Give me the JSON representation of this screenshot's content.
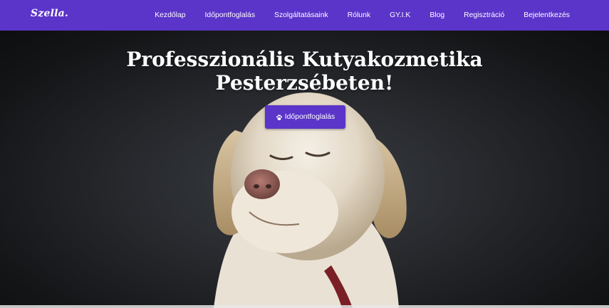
{
  "brand": {
    "name": "Szella."
  },
  "nav": {
    "items": [
      {
        "label": "Kezdőlap"
      },
      {
        "label": "Időpontfoglalás"
      },
      {
        "label": "Szolgáltatásaink"
      },
      {
        "label": "Rólunk"
      },
      {
        "label": "GY.I.K"
      },
      {
        "label": "Blog"
      },
      {
        "label": "Regisztráció"
      },
      {
        "label": "Bejelentkezés"
      }
    ]
  },
  "hero": {
    "headline_line1": "Professzionális Kutyakozmetika",
    "headline_line2": "Pesterzsébeten!",
    "cta_label": "Időpontfoglalás",
    "cta_icon": "paw-icon"
  },
  "colors": {
    "accent": "#5b34c9",
    "text": "#ffffff"
  }
}
